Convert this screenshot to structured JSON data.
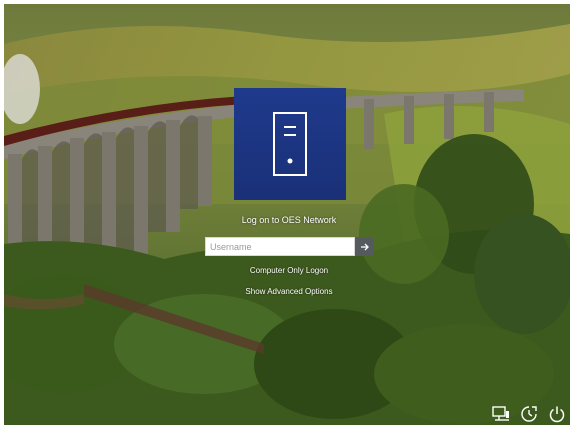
{
  "login": {
    "title": "Log on to OES Network",
    "username_placeholder": "Username",
    "username_value": "",
    "computer_only_logon": "Computer Only Logon",
    "show_advanced_options": "Show Advanced Options"
  },
  "corner_icons": [
    "network-icon",
    "ease-of-access-icon",
    "power-icon"
  ],
  "colors": {
    "tile": "#1f3a8c",
    "submit": "#555a5f"
  }
}
